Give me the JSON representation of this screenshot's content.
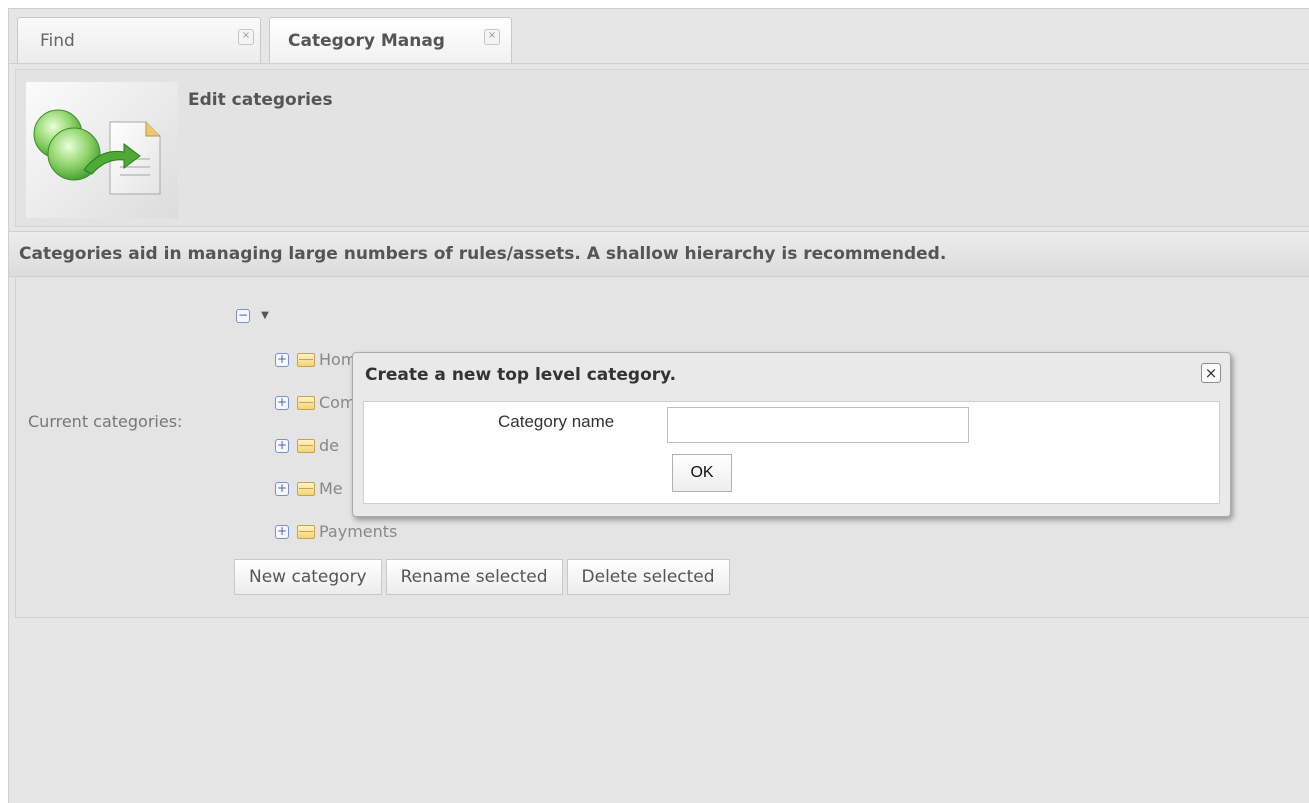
{
  "tabs": [
    {
      "label": "Find",
      "close": "×"
    },
    {
      "label": "Category Manag",
      "close": "×"
    }
  ],
  "header": {
    "title": "Edit categories",
    "logo_icon": "category-wizard-icon"
  },
  "info_text": "Categories aid in managing large numbers of rules/assets. A shallow hierarchy is recommended.",
  "categories": {
    "label": "Current categories:",
    "root_toggle": "−",
    "items": [
      {
        "name": "Home Mortgage",
        "toggle": "+"
      },
      {
        "name": "Commercial Mortgage",
        "toggle": "+"
      },
      {
        "name": "de",
        "toggle": "+"
      },
      {
        "name": "Me",
        "toggle": "+"
      },
      {
        "name": "Payments",
        "toggle": "+"
      }
    ],
    "buttons": {
      "new": "New category",
      "rename": "Rename selected",
      "delete": "Delete selected"
    }
  },
  "dialog": {
    "title": "Create a new top level category.",
    "close": "×",
    "field_label": "Category name",
    "field_value": "",
    "ok_label": "OK"
  }
}
